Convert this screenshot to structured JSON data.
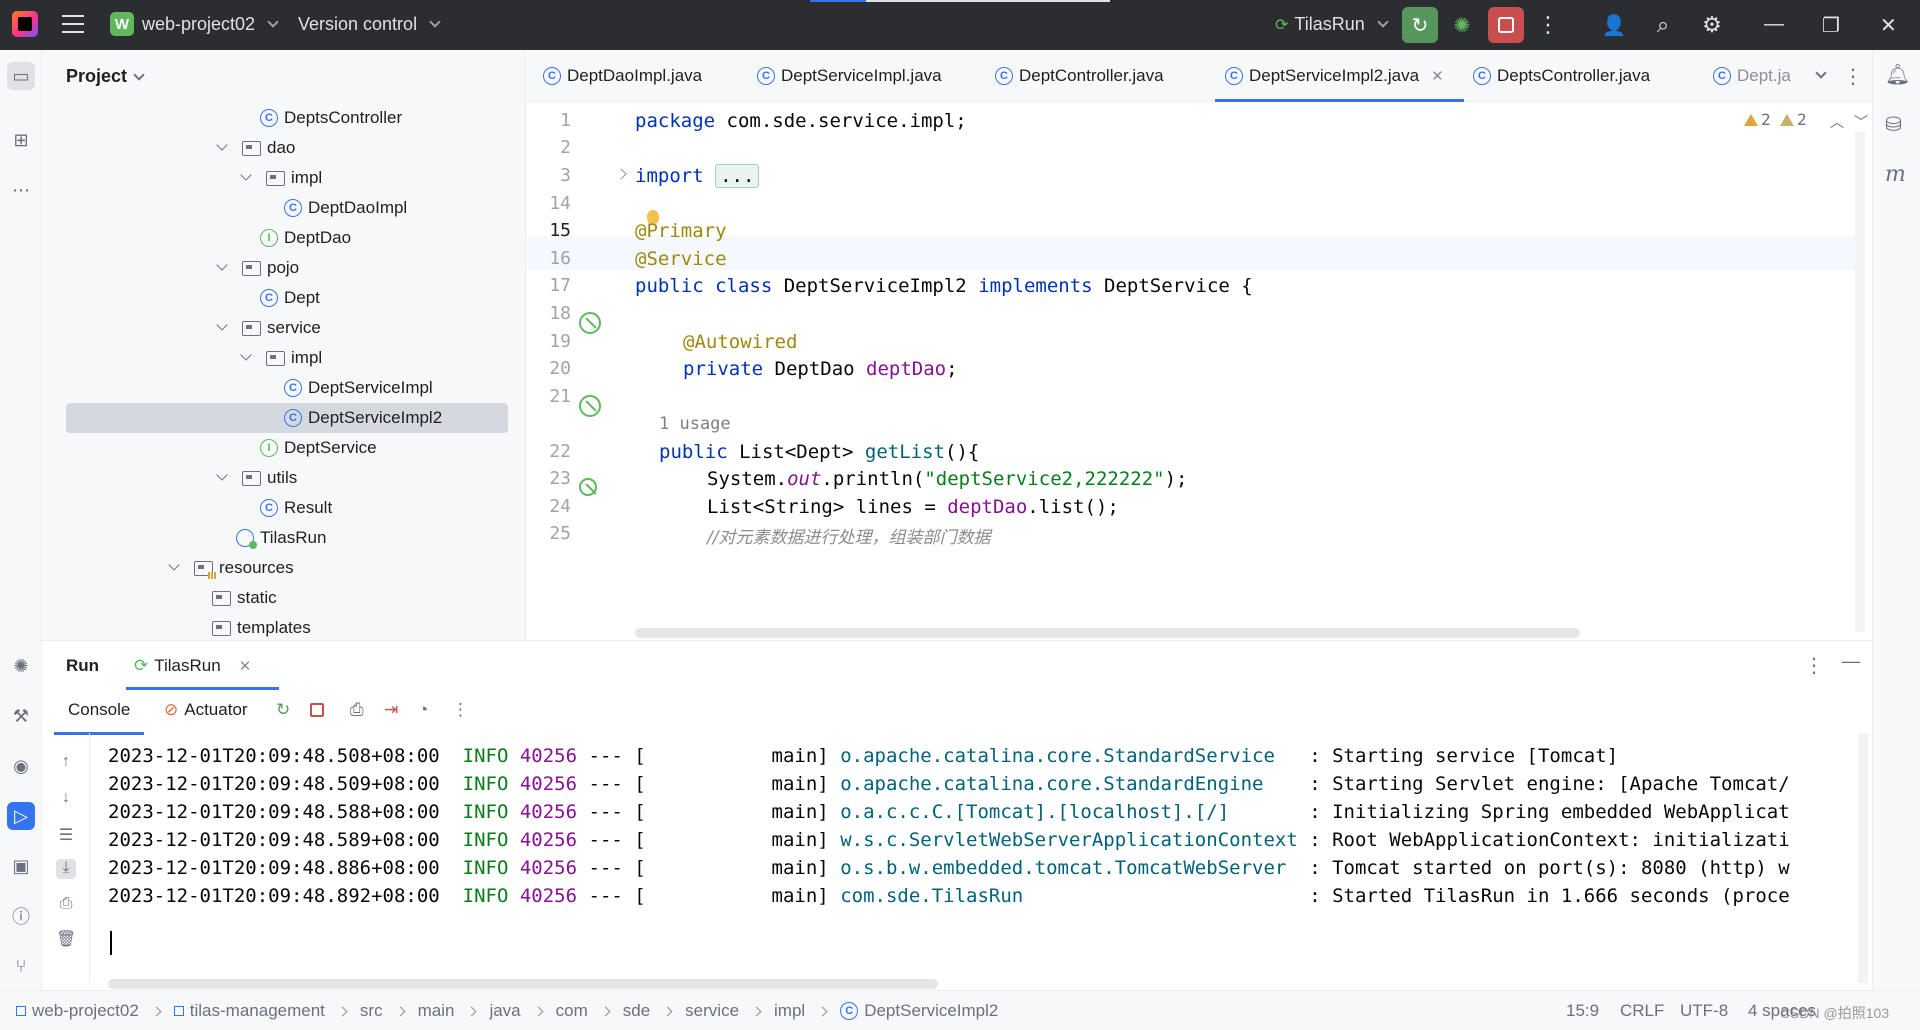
{
  "titlebar": {
    "project_badge": "W",
    "project_name": "web-project02",
    "vcs": "Version control",
    "run_config": "TilasRun"
  },
  "project_panel": {
    "title": "Project",
    "tree": [
      {
        "label": "DeptsController",
        "icon": "class-icon"
      },
      {
        "label": "dao",
        "icon": "folder-icon"
      },
      {
        "label": "impl",
        "icon": "folder-icon"
      },
      {
        "label": "DeptDaoImpl",
        "icon": "class-icon"
      },
      {
        "label": "DeptDao",
        "icon": "interface-icon"
      },
      {
        "label": "pojo",
        "icon": "folder-icon"
      },
      {
        "label": "Dept",
        "icon": "class-icon"
      },
      {
        "label": "service",
        "icon": "folder-icon"
      },
      {
        "label": "impl",
        "icon": "folder-icon"
      },
      {
        "label": "DeptServiceImpl",
        "icon": "class-icon"
      },
      {
        "label": "DeptServiceImpl2",
        "icon": "class-icon"
      },
      {
        "label": "DeptService",
        "icon": "interface-icon"
      },
      {
        "label": "utils",
        "icon": "folder-icon"
      },
      {
        "label": "Result",
        "icon": "class-icon"
      },
      {
        "label": "TilasRun",
        "icon": "spring-boot-app-icon"
      },
      {
        "label": "resources",
        "icon": "resources-folder-icon"
      },
      {
        "label": "static",
        "icon": "folder-icon"
      },
      {
        "label": "templates",
        "icon": "folder-icon"
      }
    ]
  },
  "tabs": [
    {
      "label": "DeptDaoImpl.java"
    },
    {
      "label": "DeptServiceImpl.java"
    },
    {
      "label": "DeptController.java"
    },
    {
      "label": "DeptServiceImpl2.java",
      "active": true
    },
    {
      "label": "DeptsController.java"
    },
    {
      "label": "Dept.ja"
    }
  ],
  "editor": {
    "line_numbers": [
      "1",
      "2",
      "3",
      "14",
      "15",
      "16",
      "17",
      "18",
      "19",
      "20",
      "21",
      "22",
      "23",
      "24",
      "25"
    ],
    "warnings_a": "2",
    "warnings_b": "2",
    "usage_hint": "1 usage",
    "code": {
      "l1_kw": "package",
      "l1_rest": " com.sde.service.impl;",
      "l3_kw": "import",
      "l3_fold": "...",
      "l15": "@Primary",
      "l16": "@Service",
      "l17_kw": "public class",
      "l17_name": " DeptServiceImpl2 ",
      "l17_kw2": "implements",
      "l17_rest": " DeptService {",
      "l19": "@Autowired",
      "l20_kw": "private",
      "l20_type": " DeptDao ",
      "l20_fld": "deptDao",
      "l20_end": ";",
      "l22_kw": "public",
      "l22_type": " List<Dept> ",
      "l22_meth": "getList",
      "l22_end": "(){",
      "l23_a": "System.",
      "l23_out": "out",
      "l23_b": ".println(",
      "l23_str": "\"deptService2,222222\"",
      "l23_end": ");",
      "l24_a": "List<String> lines = ",
      "l24_fld": "deptDao",
      "l24_end": ".list();",
      "l25": "//对元素数据进行处理，组装部门数据"
    }
  },
  "run_panel": {
    "title": "Run",
    "tab": "TilasRun",
    "console_tab": "Console",
    "actuator_tab": "Actuator",
    "logs": [
      {
        "ts": "2023-12-01T20:09:48.508+08:00",
        "level": "INFO",
        "pid": "40256",
        "sep": "--- [",
        "thread": "main]",
        "logger": "o.apache.catalina.core.StandardService",
        "msg": ": Starting service [Tomcat]"
      },
      {
        "ts": "2023-12-01T20:09:48.509+08:00",
        "level": "INFO",
        "pid": "40256",
        "sep": "--- [",
        "thread": "main]",
        "logger": "o.apache.catalina.core.StandardEngine",
        "msg": ": Starting Servlet engine: [Apache Tomcat/"
      },
      {
        "ts": "2023-12-01T20:09:48.588+08:00",
        "level": "INFO",
        "pid": "40256",
        "sep": "--- [",
        "thread": "main]",
        "logger": "o.a.c.c.C.[Tomcat].[localhost].[/]",
        "msg": ": Initializing Spring embedded WebApplicat"
      },
      {
        "ts": "2023-12-01T20:09:48.589+08:00",
        "level": "INFO",
        "pid": "40256",
        "sep": "--- [",
        "thread": "main]",
        "logger": "w.s.c.ServletWebServerApplicationContext",
        "msg": ": Root WebApplicationContext: initializati"
      },
      {
        "ts": "2023-12-01T20:09:48.886+08:00",
        "level": "INFO",
        "pid": "40256",
        "sep": "--- [",
        "thread": "main]",
        "logger": "o.s.b.w.embedded.tomcat.TomcatWebServer",
        "msg": ": Tomcat started on port(s): 8080 (http) w"
      },
      {
        "ts": "2023-12-01T20:09:48.892+08:00",
        "level": "INFO",
        "pid": "40256",
        "sep": "--- [",
        "thread": "main]",
        "logger": "com.sde.TilasRun",
        "msg": ": Started TilasRun in 1.666 seconds (proce"
      }
    ]
  },
  "statusbar": {
    "breadcrumbs": [
      "web-project02",
      "tilas-management",
      "src",
      "main",
      "java",
      "com",
      "sde",
      "service",
      "impl",
      "DeptServiceImpl2"
    ],
    "position": "15:9",
    "line_sep": "CRLF",
    "encoding": "UTF-8",
    "indent": "4 spaces",
    "watermark": "CSDN @拍照103"
  },
  "colors": {
    "accent": "#3574f0",
    "run_green": "#57965c",
    "stop_red": "#c94f4f"
  }
}
